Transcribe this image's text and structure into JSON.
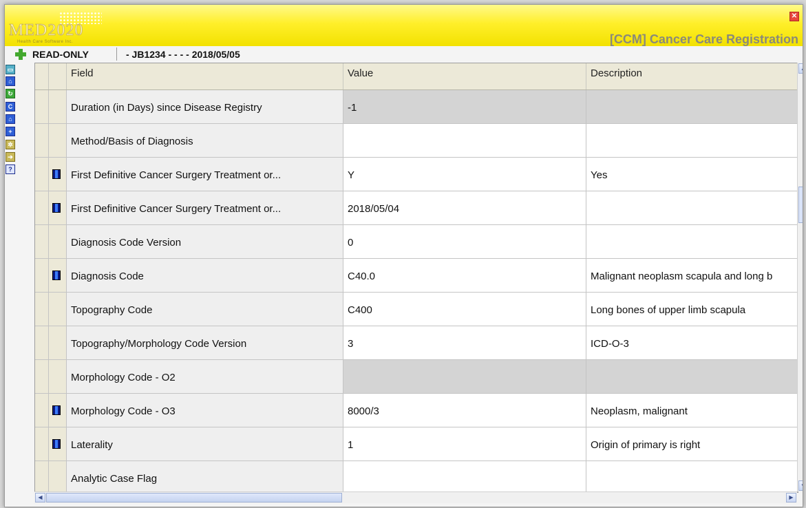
{
  "banner": {
    "logo_text": "MED2020",
    "logo_subtitle": "Health Care Software Inc.",
    "app_title": "[CCM] Cancer Care Registration",
    "close_icon": "close-icon"
  },
  "status": {
    "mode": "READ-ONLY",
    "record": "- JB1234 - - - - 2018/05/05"
  },
  "toolbar": {
    "icons": [
      "window-icon",
      "home-icon",
      "refresh-icon",
      "copy-icon",
      "home-icon",
      "add-icon",
      "settings-icon",
      "export-icon",
      "help-icon"
    ]
  },
  "grid": {
    "headers": {
      "field": "Field",
      "value": "Value",
      "description": "Description"
    },
    "rows": [
      {
        "field": "Duration (in Days) since Disease Registry",
        "value": "-1",
        "description": "",
        "indicator": false,
        "grey_value": true,
        "grey_desc": true
      },
      {
        "field": "Method/Basis of Diagnosis",
        "value": "",
        "description": "",
        "indicator": false
      },
      {
        "field": "First Definitive Cancer Surgery Treatment or...",
        "value": "Y",
        "description": "Yes",
        "indicator": true
      },
      {
        "field": "First Definitive Cancer Surgery Treatment or...",
        "value": "2018/05/04",
        "description": "",
        "indicator": true
      },
      {
        "field": "Diagnosis Code Version",
        "value": "0",
        "description": "",
        "indicator": false
      },
      {
        "field": "Diagnosis Code",
        "value": "C40.0",
        "description": "Malignant neoplasm scapula and long b",
        "indicator": true
      },
      {
        "field": "Topography Code",
        "value": "C400",
        "description": "Long bones of upper limb scapula",
        "indicator": false
      },
      {
        "field": "Topography/Morphology Code Version",
        "value": "3",
        "description": "ICD-O-3",
        "indicator": false
      },
      {
        "field": "Morphology Code - O2",
        "value": "",
        "description": "",
        "indicator": false,
        "grey_value": true,
        "grey_desc": true
      },
      {
        "field": "Morphology Code - O3",
        "value": "8000/3",
        "description": "Neoplasm, malignant",
        "indicator": true
      },
      {
        "field": "Laterality",
        "value": "1",
        "description": "Origin of primary is right",
        "indicator": true
      },
      {
        "field": "Analytic Case Flag",
        "value": "",
        "description": "",
        "indicator": false
      }
    ]
  }
}
